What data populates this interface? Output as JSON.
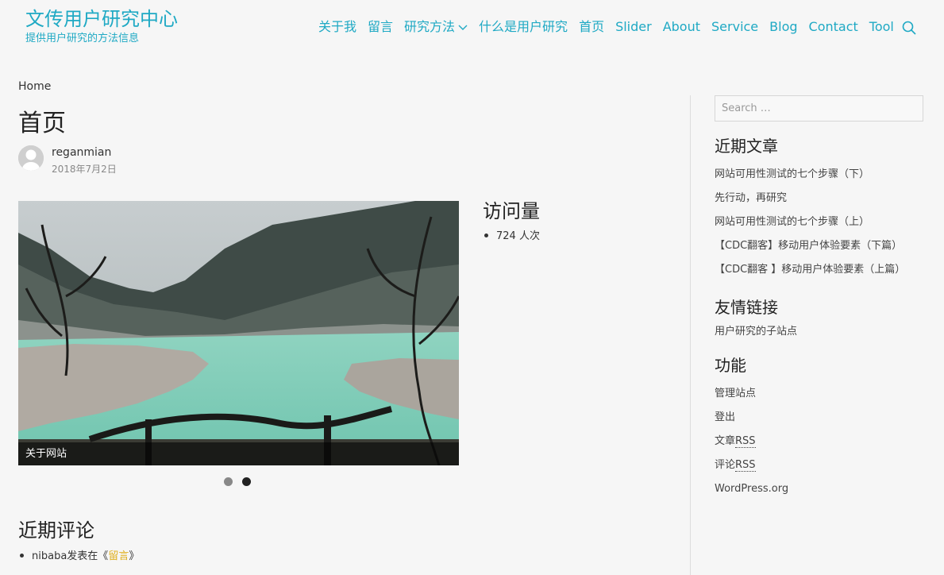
{
  "header": {
    "site_title": "文传用户研究中心",
    "site_description": "提供用户研究的方法信息",
    "nav": [
      {
        "label": "关于我",
        "has_dropdown": false
      },
      {
        "label": "留言",
        "has_dropdown": false
      },
      {
        "label": "研究方法",
        "has_dropdown": true
      },
      {
        "label": "什么是用户研究",
        "has_dropdown": false
      },
      {
        "label": "首页",
        "has_dropdown": false
      },
      {
        "label": "Slider",
        "has_dropdown": false
      },
      {
        "label": "About",
        "has_dropdown": false
      },
      {
        "label": "Service",
        "has_dropdown": false
      },
      {
        "label": "Blog",
        "has_dropdown": false
      },
      {
        "label": "Contact",
        "has_dropdown": false
      },
      {
        "label": "Tool",
        "has_dropdown": false
      }
    ],
    "search_icon": "search-icon"
  },
  "main": {
    "breadcrumb": "Home",
    "title": "首页",
    "author": "reganmian",
    "date": "2018年7月2日",
    "slider": {
      "caption": "关于网站",
      "dots": 2,
      "active_dot": 2
    },
    "visits": {
      "title": "访问量",
      "items": [
        "724 人次"
      ]
    },
    "recent_comments": {
      "title": "近期评论",
      "items": [
        {
          "author": "nibaba",
          "text": "发表在《",
          "link": "留言",
          "close": "》"
        }
      ]
    }
  },
  "sidebar": {
    "search_placeholder": "Search …",
    "recent_posts": {
      "title": "近期文章",
      "items": [
        "网站可用性测试的七个步骤（下）",
        "先行动，再研究",
        "网站可用性测试的七个步骤（上）",
        "【CDC翻客】移动用户体验要素（下篇）",
        "【CDC翻客 】移动用户体验要素（上篇）"
      ]
    },
    "links": {
      "title": "友情链接",
      "items": [
        "用户研究的子站点"
      ]
    },
    "meta": {
      "title": "功能",
      "items": [
        {
          "pre": "管理站点",
          "abbr": ""
        },
        {
          "pre": "登出",
          "abbr": ""
        },
        {
          "pre": "文章",
          "abbr": "RSS"
        },
        {
          "pre": "评论",
          "abbr": "RSS"
        },
        {
          "pre": "WordPress.org",
          "abbr": ""
        }
      ]
    }
  },
  "colors": {
    "accent": "#1fa9c4",
    "link_highlight": "#e0b020",
    "background": "#f6f6f6"
  }
}
